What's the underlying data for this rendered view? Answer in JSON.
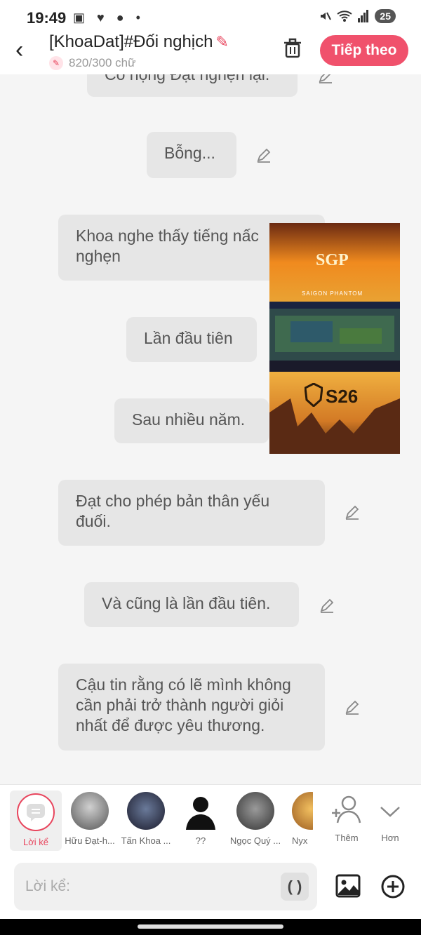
{
  "status_bar": {
    "time": "19:49",
    "left_icons": "▣ ♥ ● •",
    "battery": "25"
  },
  "header": {
    "title": "[KhoaDat]#Đối nghịch",
    "char_count": "820/300 chữ",
    "next_label": "Tiếp theo",
    "accent_color": "#f0516c"
  },
  "messages": [
    {
      "text": "Cổ họng Đạt nghẹn lại."
    },
    {
      "text": "Bỗng..."
    },
    {
      "text": "Khoa nghe thấy tiếng nấc nghẹn"
    },
    {
      "text": "Lần đầu tiên"
    },
    {
      "text": "Sau nhiều năm."
    },
    {
      "text": "Đạt cho phép bản thân yếu đuối."
    },
    {
      "text": "Và cũng là lần đầu tiên."
    },
    {
      "text": "Cậu tin rằng có lẽ mình không cần phải trở thành người giỏi nhất để được yêu thương."
    }
  ],
  "thumbnail": {
    "top_brand": "SGP",
    "top_caption": "SAIGON PHANTOM",
    "bottom_brand": "S26"
  },
  "characters": [
    {
      "label": "Lời kể"
    },
    {
      "label": "Hữu Đạt-h..."
    },
    {
      "label": "Tấn Khoa ..."
    },
    {
      "label": "??"
    },
    {
      "label": "Ngọc Quý ..."
    },
    {
      "label": "Nyx"
    },
    {
      "label": "Thêm"
    },
    {
      "label": "Hơn"
    }
  ],
  "input": {
    "placeholder": "Lời kể:",
    "paren_label": "( )"
  }
}
